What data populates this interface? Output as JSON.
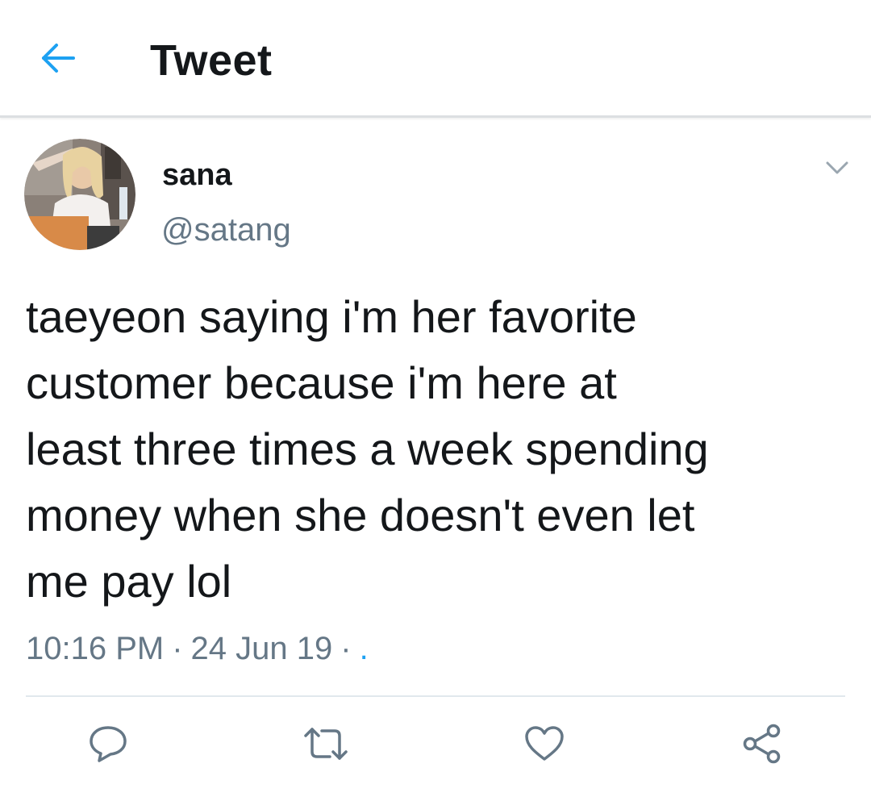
{
  "header": {
    "back_icon": "arrow-left-icon",
    "title": "Tweet"
  },
  "tweet": {
    "author": {
      "display_name": "sana",
      "handle": "@satang",
      "avatar": "profile-photo"
    },
    "caret_icon": "chevron-down-icon",
    "text": "taeyeon saying i'm her favorite\ncustomer because i'm here at\nleast three times a week spending\nmoney when she doesn't even let\nme pay lol",
    "time": "10:16 PM",
    "date": "24 Jun 19",
    "separator": "·",
    "source": "."
  },
  "actions": [
    {
      "name": "reply",
      "icon": "reply-icon"
    },
    {
      "name": "retweet",
      "icon": "retweet-icon"
    },
    {
      "name": "like",
      "icon": "heart-icon"
    },
    {
      "name": "share",
      "icon": "share-icon"
    }
  ],
  "colors": {
    "accent": "#1da1f2",
    "text_primary": "#14171a",
    "text_secondary": "#657786",
    "divider": "#e1e8ed"
  }
}
